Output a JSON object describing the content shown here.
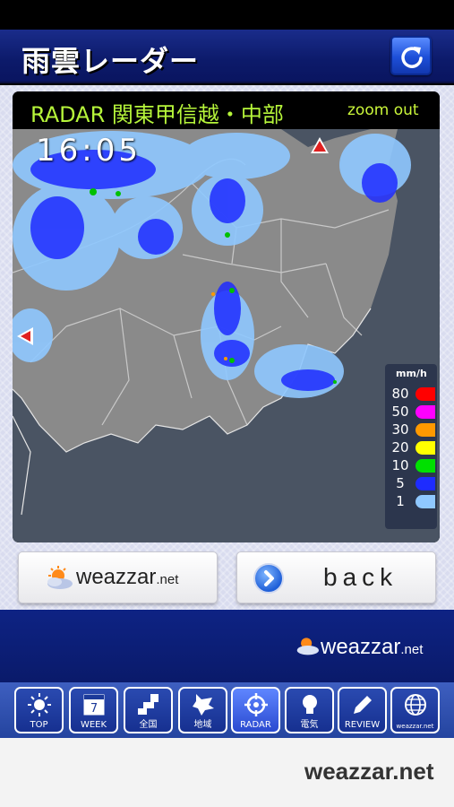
{
  "app": {
    "title": "雨雲レーダー"
  },
  "radar": {
    "title": "RADAR 関東甲信越・中部",
    "zoom_label": "zoom out",
    "time": "16:05",
    "legend": {
      "unit": "mm/h",
      "levels": [
        {
          "label": "80",
          "color": "#ff0000"
        },
        {
          "label": "50",
          "color": "#ff00ff"
        },
        {
          "label": "30",
          "color": "#ff9900"
        },
        {
          "label": "20",
          "color": "#ffff00"
        },
        {
          "label": "10",
          "color": "#00e000"
        },
        {
          "label": "5",
          "color": "#1e2cff"
        },
        {
          "label": "1",
          "color": "#8fc8ff"
        }
      ]
    }
  },
  "buttons": {
    "weazzar_brand": "weazzar",
    "weazzar_suffix": ".net",
    "back_label": "back"
  },
  "band_logo": {
    "brand": "weazzar",
    "suffix": ".net"
  },
  "tabs": [
    {
      "label": "TOP",
      "icon": "sun-icon"
    },
    {
      "label": "WEEK",
      "icon": "calendar-icon"
    },
    {
      "label": "全国",
      "icon": "japan-map-icon"
    },
    {
      "label": "地域",
      "icon": "hokkaido-map-icon"
    },
    {
      "label": "RADAR",
      "icon": "crosshair-icon"
    },
    {
      "label": "電気",
      "icon": "lightbulb-icon"
    },
    {
      "label": "REVIEW",
      "icon": "pencil-icon"
    },
    {
      "label": "weazzar.net",
      "icon": "globe-icon"
    }
  ],
  "tab_calendar_day": "7",
  "footer": {
    "brand": "weazzar.net"
  },
  "colors": {
    "title_bar": "#0c1a6a",
    "radar_title": "#b6f53a",
    "map_land": "#8a8a8a",
    "map_sea": "#4a5463"
  }
}
